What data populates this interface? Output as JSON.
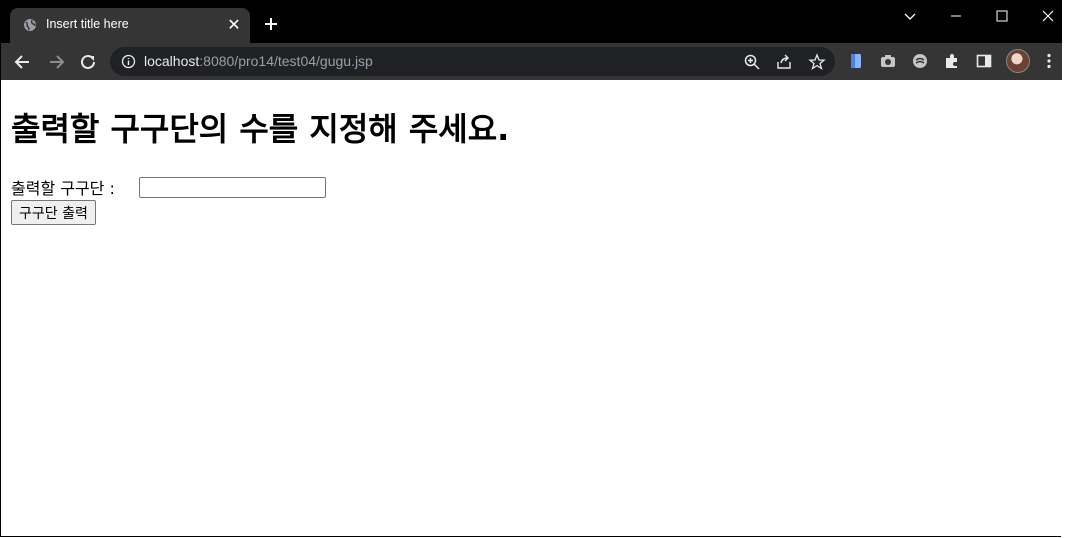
{
  "browser": {
    "tab": {
      "title": "Insert title here",
      "close_glyph": "✕",
      "icon": "globe-icon"
    },
    "new_tab_glyph": "+",
    "address": {
      "host": "localhost",
      "path": ":8080/pro14/test04/gugu.jsp"
    },
    "icons": {
      "back": "arrow-left-icon",
      "forward": "arrow-right-icon",
      "reload": "reload-icon",
      "site_info": "info-icon",
      "zoom": "zoom-in-icon",
      "share": "share-icon",
      "bookmark": "star-icon",
      "extensions": "puzzle-icon",
      "side_panel": "side-panel-icon",
      "menu": "kebab-menu-icon"
    },
    "colors": {
      "titlebar": "#000000",
      "toolbar": "#353535",
      "omnibox": "#202124",
      "url_host": "#e8eaed",
      "url_path": "#9aa0a6"
    }
  },
  "page": {
    "heading": "출력할 구구단의 수를 지정해 주세요.",
    "form": {
      "label": "출력할 구구단 :",
      "input_value": "",
      "submit_label": "구구단 출력"
    }
  }
}
